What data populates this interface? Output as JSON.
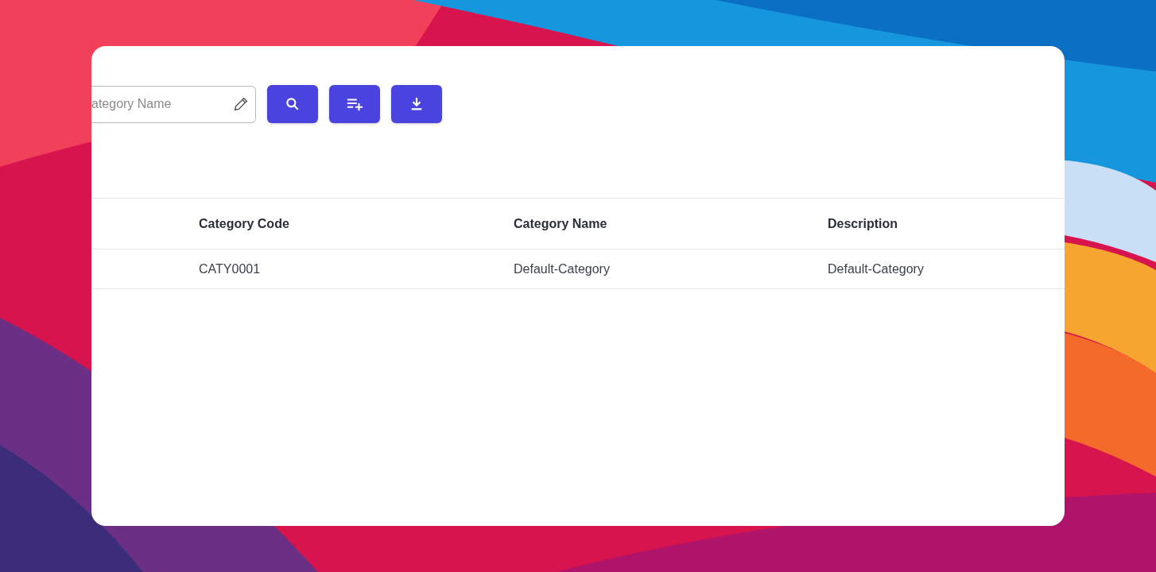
{
  "search": {
    "placeholder": "ategory Name"
  },
  "table": {
    "columns": [
      "Category Code",
      "Category Name",
      "Description"
    ],
    "rows": [
      [
        "CATY0001",
        "Default-Category",
        "Default-Category"
      ]
    ]
  }
}
